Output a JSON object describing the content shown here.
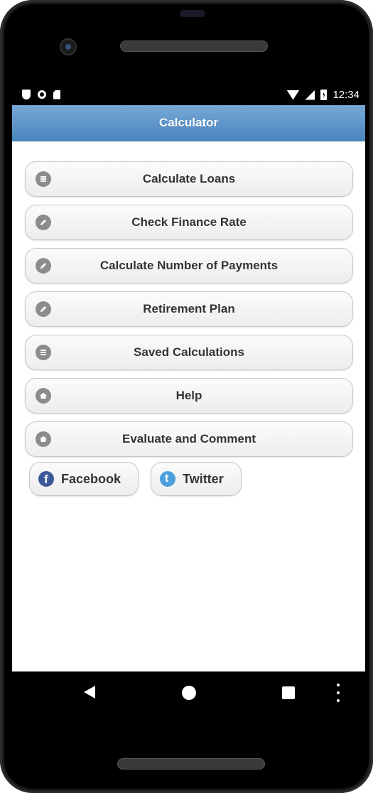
{
  "status_bar": {
    "time": "12:34",
    "left_icons": [
      "shield-icon",
      "circle-icon",
      "sd-card-icon"
    ],
    "right_icons": [
      "wifi-icon",
      "signal-icon",
      "battery-charging-icon"
    ]
  },
  "header": {
    "title": "Calculator"
  },
  "menu": {
    "items": [
      {
        "label": "Calculate Loans",
        "icon": "list-icon"
      },
      {
        "label": "Check Finance Rate",
        "icon": "pencil-icon"
      },
      {
        "label": "Calculate Number of Payments",
        "icon": "pencil-icon"
      },
      {
        "label": "Retirement Plan",
        "icon": "pencil-icon"
      },
      {
        "label": "Saved Calculations",
        "icon": "list-icon"
      },
      {
        "label": "Help",
        "icon": "home-icon"
      },
      {
        "label": "Evaluate and Comment",
        "icon": "home-icon"
      }
    ]
  },
  "social": {
    "facebook_label": "Facebook",
    "twitter_label": "Twitter"
  },
  "colors": {
    "header_top": "#77a8d6",
    "header_bottom": "#4a86bf",
    "facebook": "#3b5998",
    "twitter": "#4aa0dc",
    "button_icon": "#8c8c8c"
  }
}
